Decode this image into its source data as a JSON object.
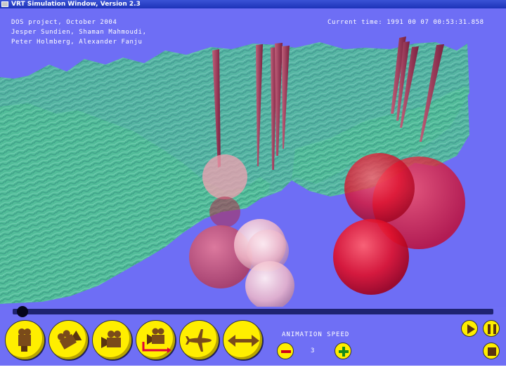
{
  "window": {
    "title": "VRT Simulation Window, Version 2.3"
  },
  "overlay": {
    "credits": [
      "DOS project, October 2004",
      "Jesper Sundien, Shaman Mahmoudi,",
      "Peter Holmberg, Alexander Fanju"
    ],
    "clock_label": "Current time:",
    "clock_value": "1991 00 07 00:53:31.858"
  },
  "timeline": {
    "progress": 0.02
  },
  "controls": {
    "camera_buttons": [
      {
        "icon": "camera-front-icon"
      },
      {
        "icon": "camera-tilted-icon"
      },
      {
        "icon": "camera-side-icon"
      },
      {
        "icon": "camera-path-icon"
      },
      {
        "icon": "airplane-icon"
      },
      {
        "icon": "pan-arrows-icon"
      }
    ],
    "speed_label": "ANIMATION SPEED",
    "speed_value": "3",
    "minus_icon": "minus-icon",
    "plus_icon": "plus-icon",
    "play_icon": "play-icon",
    "pause_icon": "pause-icon",
    "stop_icon": "stop-icon"
  },
  "colors": {
    "background": "#6f6ff5",
    "terrain": "#4fc98c",
    "button_yellow": "#ffee00",
    "timeline": "#1f2372"
  }
}
